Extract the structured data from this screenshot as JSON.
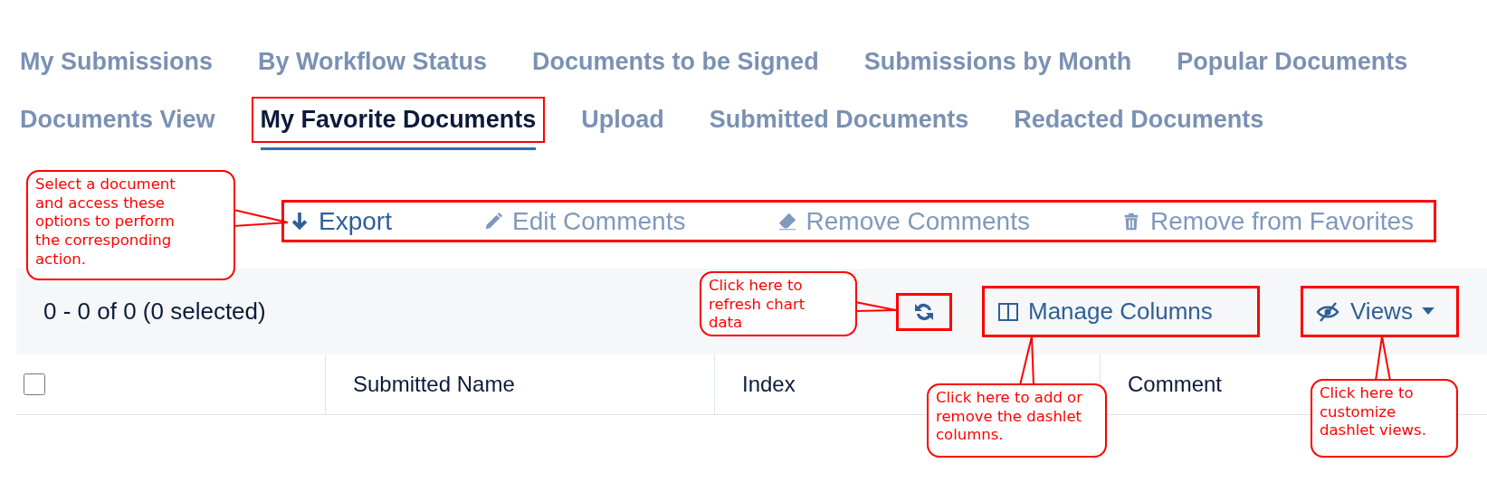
{
  "tab_rows": [
    [
      {
        "label": "My Submissions",
        "selected": false
      },
      {
        "label": "By Workflow Status",
        "selected": false
      },
      {
        "label": "Documents to be Signed",
        "selected": false
      },
      {
        "label": "Submissions by Month",
        "selected": false
      },
      {
        "label": "Popular Documents",
        "selected": false
      }
    ],
    [
      {
        "label": "Documents View",
        "selected": false
      },
      {
        "label": "My Favorite Documents",
        "selected": true
      },
      {
        "label": "Upload",
        "selected": false
      },
      {
        "label": "Submitted Documents",
        "selected": false
      },
      {
        "label": "Redacted Documents",
        "selected": false
      }
    ]
  ],
  "toolbar": [
    {
      "kind": "export",
      "label": "Export",
      "disabled": false
    },
    {
      "kind": "edit",
      "label": "Edit Comments",
      "disabled": true
    },
    {
      "kind": "erase",
      "label": "Remove Comments",
      "disabled": true
    },
    {
      "kind": "delete",
      "label": "Remove from Favorites",
      "disabled": true
    }
  ],
  "grid_bar": {
    "count": "0 - 0 of 0 (0 selected)",
    "manage_columns": "Manage Columns",
    "views": "Views"
  },
  "table": {
    "select_all": {
      "checked": false
    },
    "columns": [
      "Submitted Name",
      "Index",
      "Comment"
    ]
  },
  "callouts": [
    {
      "kind": "toolbar",
      "text": "Select a document and access these options to perform the corresponding action."
    },
    {
      "kind": "refresh",
      "text": "Click here to refresh chart data"
    },
    {
      "kind": "columns",
      "text": "Click here to add or remove the dashlet columns."
    },
    {
      "kind": "views",
      "text": "Click here to customize dashlet views."
    }
  ]
}
